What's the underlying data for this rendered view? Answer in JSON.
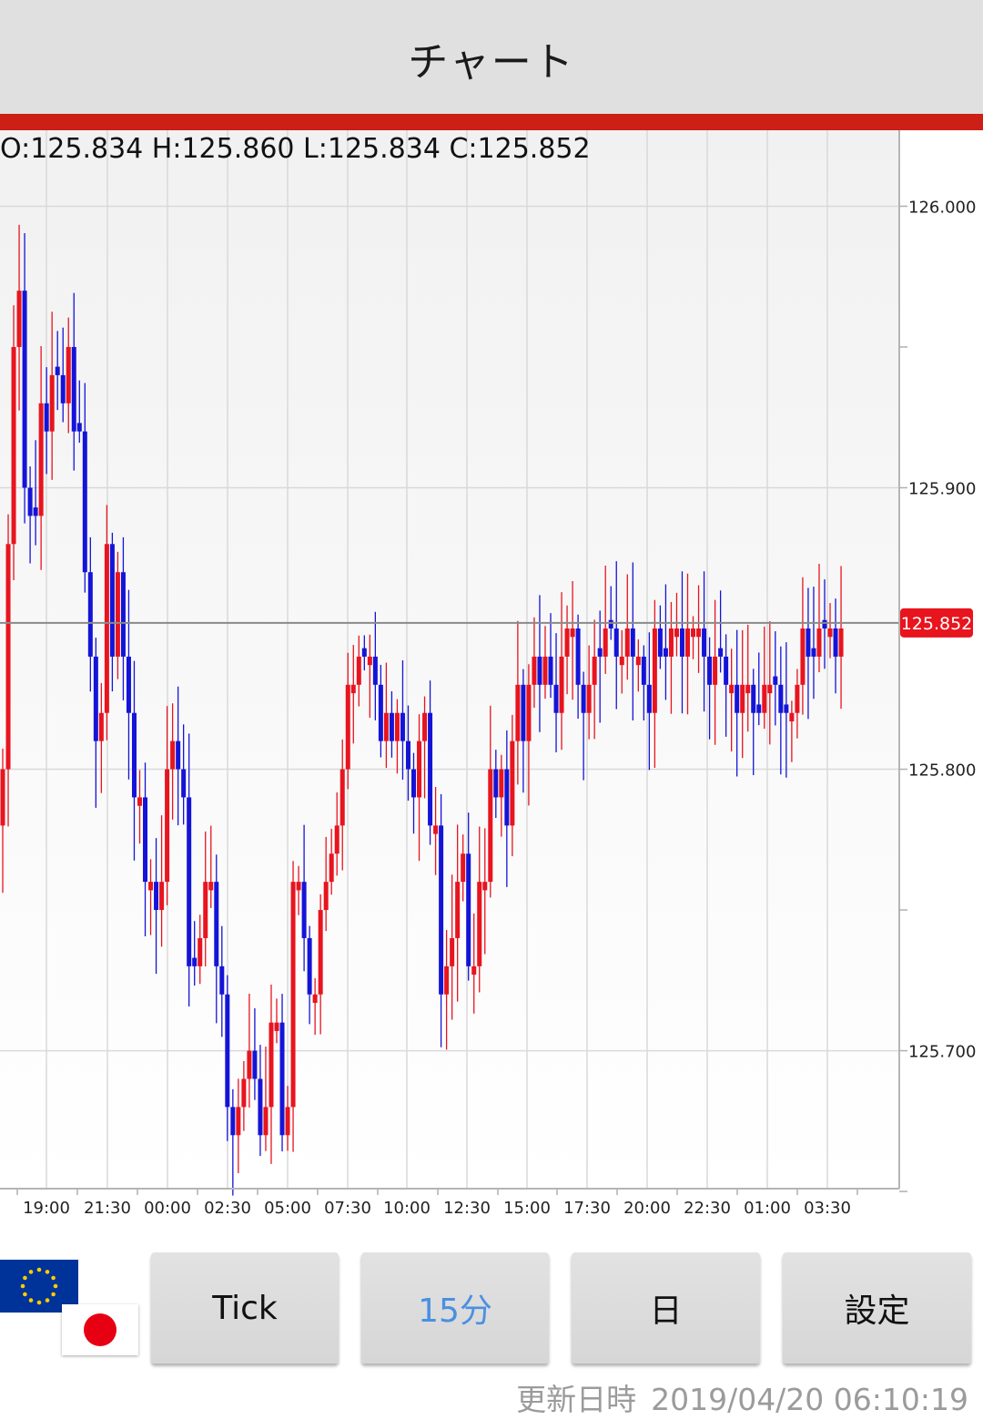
{
  "header": {
    "title": "チャート"
  },
  "ohlc": {
    "text": "O:125.834 H:125.860 L:125.834 C:125.852"
  },
  "chart_data": {
    "type": "candlestick",
    "pair_flags": [
      "eu-flag-icon",
      "japan-flag-icon"
    ],
    "ylim": [
      125.651,
      126.027
    ],
    "y_ticks": [
      126.0,
      125.95,
      125.9,
      125.85,
      125.8,
      125.75,
      125.7,
      125.65
    ],
    "y_tick_labels": [
      "126.000",
      "125.900",
      "125.800",
      "125.700"
    ],
    "x_tick_labels": [
      "19:00",
      "21:30",
      "00:00",
      "02:30",
      "05:00",
      "07:30",
      "10:00",
      "12:30",
      "15:00",
      "17:30",
      "20:00",
      "22:30",
      "01:00",
      "03:30"
    ],
    "current_price": 125.852,
    "current_price_label": "125.852",
    "up_color": "#e8141e",
    "down_color": "#1414d8",
    "close_series": [
      125.8,
      125.88,
      125.95,
      125.97,
      125.9,
      125.89,
      125.89,
      125.93,
      125.92,
      125.94,
      125.94,
      125.93,
      125.95,
      125.92,
      125.92,
      125.87,
      125.84,
      125.81,
      125.82,
      125.88,
      125.84,
      125.87,
      125.84,
      125.82,
      125.79,
      125.79,
      125.76,
      125.76,
      125.75,
      125.76,
      125.8,
      125.81,
      125.8,
      125.79,
      125.73,
      125.73,
      125.74,
      125.76,
      125.76,
      125.73,
      125.72,
      125.68,
      125.67,
      125.68,
      125.69,
      125.7,
      125.69,
      125.67,
      125.68,
      125.71,
      125.71,
      125.67,
      125.68,
      125.76,
      125.76,
      125.74,
      125.72,
      125.72,
      125.75,
      125.76,
      125.77,
      125.78,
      125.8,
      125.83,
      125.83,
      125.84,
      125.84,
      125.84,
      125.83,
      125.81,
      125.82,
      125.81,
      125.82,
      125.81,
      125.8,
      125.79,
      125.81,
      125.82,
      125.78,
      125.78,
      125.72,
      125.73,
      125.74,
      125.76,
      125.77,
      125.73,
      125.73,
      125.76,
      125.76,
      125.8,
      125.79,
      125.8,
      125.78,
      125.81,
      125.83,
      125.81,
      125.83,
      125.84,
      125.83,
      125.84,
      125.83,
      125.82,
      125.84,
      125.85,
      125.85,
      125.83,
      125.82,
      125.83,
      125.84,
      125.84,
      125.85,
      125.85,
      125.84,
      125.84,
      125.85,
      125.84,
      125.84,
      125.83,
      125.82,
      125.85,
      125.84,
      125.84,
      125.85,
      125.85,
      125.84,
      125.85,
      125.85,
      125.85,
      125.84,
      125.83,
      125.84,
      125.84,
      125.83,
      125.83,
      125.82,
      125.83,
      125.83,
      125.82,
      125.82,
      125.83,
      125.83,
      125.83,
      125.82,
      125.82,
      125.82,
      125.83,
      125.85,
      125.84,
      125.84,
      125.85,
      125.85,
      125.85,
      125.84,
      125.85
    ]
  },
  "toolbar": {
    "buttons": [
      {
        "label": "Tick",
        "active": false
      },
      {
        "label": "15分",
        "active": true
      },
      {
        "label": "日",
        "active": false
      },
      {
        "label": "設定",
        "active": false
      }
    ]
  },
  "footer": {
    "updated_label": "更新日時",
    "updated_value": "2019/04/20 06:10:19"
  }
}
